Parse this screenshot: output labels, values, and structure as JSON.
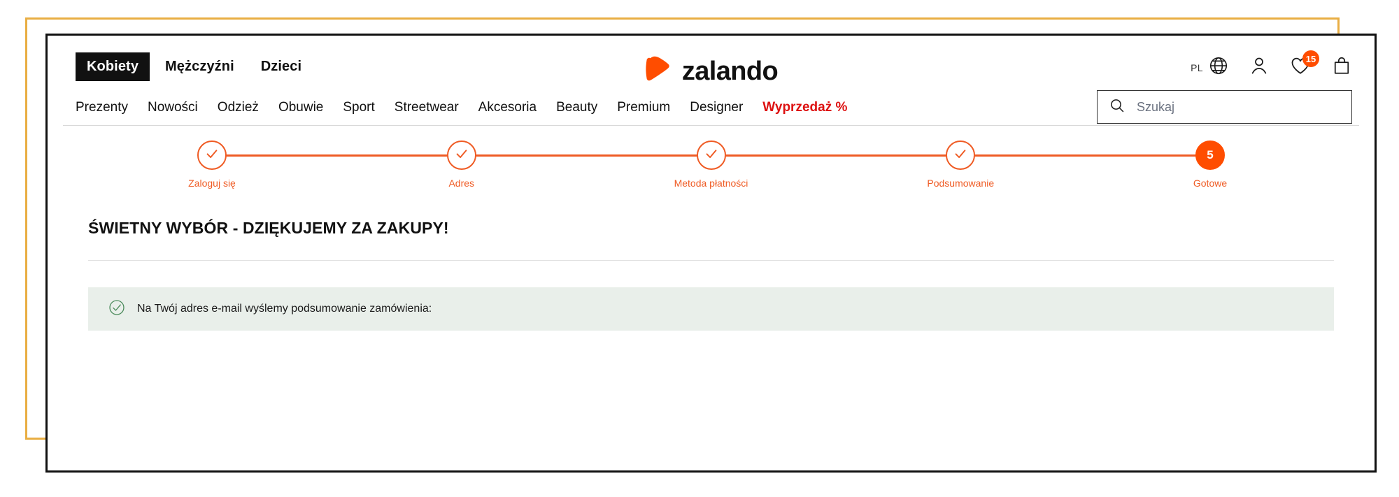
{
  "header": {
    "gender_tabs": [
      {
        "label": "Kobiety",
        "active": true
      },
      {
        "label": "Mężczyźni",
        "active": false
      },
      {
        "label": "Dzieci",
        "active": false
      }
    ],
    "logo": {
      "wordmark": "zalando",
      "mark_icon": "zalando-play-mark",
      "mark_color": "#ff4d00"
    },
    "icons": {
      "language_label": "PL",
      "globe_icon": "globe-icon",
      "account_icon": "person-icon",
      "wishlist_icon": "heart-icon",
      "wishlist_count": "15",
      "wishlist_badge_color": "#ff4d00",
      "bag_icon": "shopping-bag-icon"
    }
  },
  "nav": {
    "items": [
      {
        "label": "Prezenty",
        "sale": false
      },
      {
        "label": "Nowości",
        "sale": false
      },
      {
        "label": "Odzież",
        "sale": false
      },
      {
        "label": "Obuwie",
        "sale": false
      },
      {
        "label": "Sport",
        "sale": false
      },
      {
        "label": "Streetwear",
        "sale": false
      },
      {
        "label": "Akcesoria",
        "sale": false
      },
      {
        "label": "Beauty",
        "sale": false
      },
      {
        "label": "Premium",
        "sale": false
      },
      {
        "label": "Designer",
        "sale": false
      },
      {
        "label": "Wyprzedaż %",
        "sale": true
      }
    ],
    "sale_color": "#dd1111"
  },
  "search": {
    "icon": "search-icon",
    "placeholder": "Szukaj",
    "value": ""
  },
  "checkout_steps": {
    "accent_color": "#ef5b24",
    "current_color": "#ff4d00",
    "steps": [
      {
        "label": "Zaloguj się",
        "state": "complete",
        "marker": "check-icon"
      },
      {
        "label": "Adres",
        "state": "complete",
        "marker": "check-icon"
      },
      {
        "label": "Metoda płatności",
        "state": "complete",
        "marker": "check-icon"
      },
      {
        "label": "Podsumowanie",
        "state": "complete",
        "marker": "check-icon"
      },
      {
        "label": "Gotowe",
        "state": "current",
        "marker": "5"
      }
    ]
  },
  "main": {
    "title": "ŚWIETNY WYBÓR - DZIĘKUJEMY ZA ZAKUPY!",
    "notice": {
      "icon": "circle-check-icon",
      "icon_color": "#4a8a5a",
      "background": "#e9efea",
      "text": "Na Twój adres e-mail wyślemy podsumowanie zamówienia:"
    }
  },
  "frames": {
    "outer_color": "#e9ae43",
    "inner_color": "#111111"
  }
}
